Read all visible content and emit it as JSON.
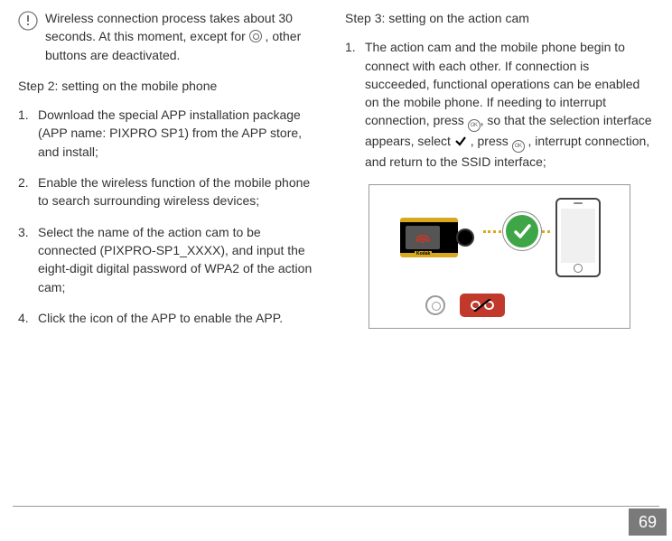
{
  "left": {
    "note": "Wireless connection process takes about 30 seconds. At this moment, except for ",
    "note_tail": " , other buttons are deactivated.",
    "step2_heading": "Step 2: setting on the mobile phone",
    "items": [
      "Download the special APP installation package (APP name: PIXPRO SP1) from the APP store, and install;",
      "Enable the wireless function of the mobile phone to search surrounding wireless devices;",
      "Select the name of the action cam to be connected (PIXPRO-SP1_XXXX), and input the eight-digit digital password of WPA2 of the action cam;",
      "Click the icon of the APP to enable the APP."
    ]
  },
  "right": {
    "step3_heading": "Step 3: setting on the action cam",
    "item1_a": "The action cam and the mobile phone begin to connect with each other. If connection is succeeded, functional operations can be enabled on the mobile phone. If needing to interrupt connection, press ",
    "item1_b": ", so that the selection interface appears, select ",
    "item1_c": " , press ",
    "item1_d": " , interrupt connection, and return to the SSID interface;"
  },
  "cam_brand": "Kodak",
  "page_number": "69"
}
